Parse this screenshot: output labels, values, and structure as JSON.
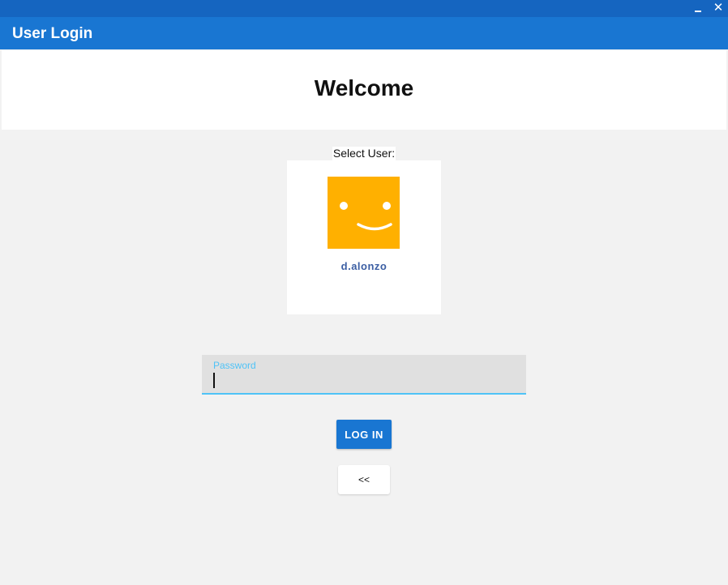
{
  "window": {
    "minimize_icon": "minimize-icon",
    "close_glyph": "✕",
    "bar_color": "#1565c0"
  },
  "header": {
    "title": "User Login",
    "color": "#1976d2"
  },
  "welcome": {
    "text": "Welcome"
  },
  "user_select": {
    "label": "Select User:",
    "users": [
      {
        "name": "d.alonzo",
        "avatar_icon": "smiley-face-icon",
        "avatar_color": "#ffb000"
      }
    ]
  },
  "password": {
    "label": "Password",
    "value": ""
  },
  "actions": {
    "login_label": "LOG IN",
    "back_label": "<<"
  }
}
